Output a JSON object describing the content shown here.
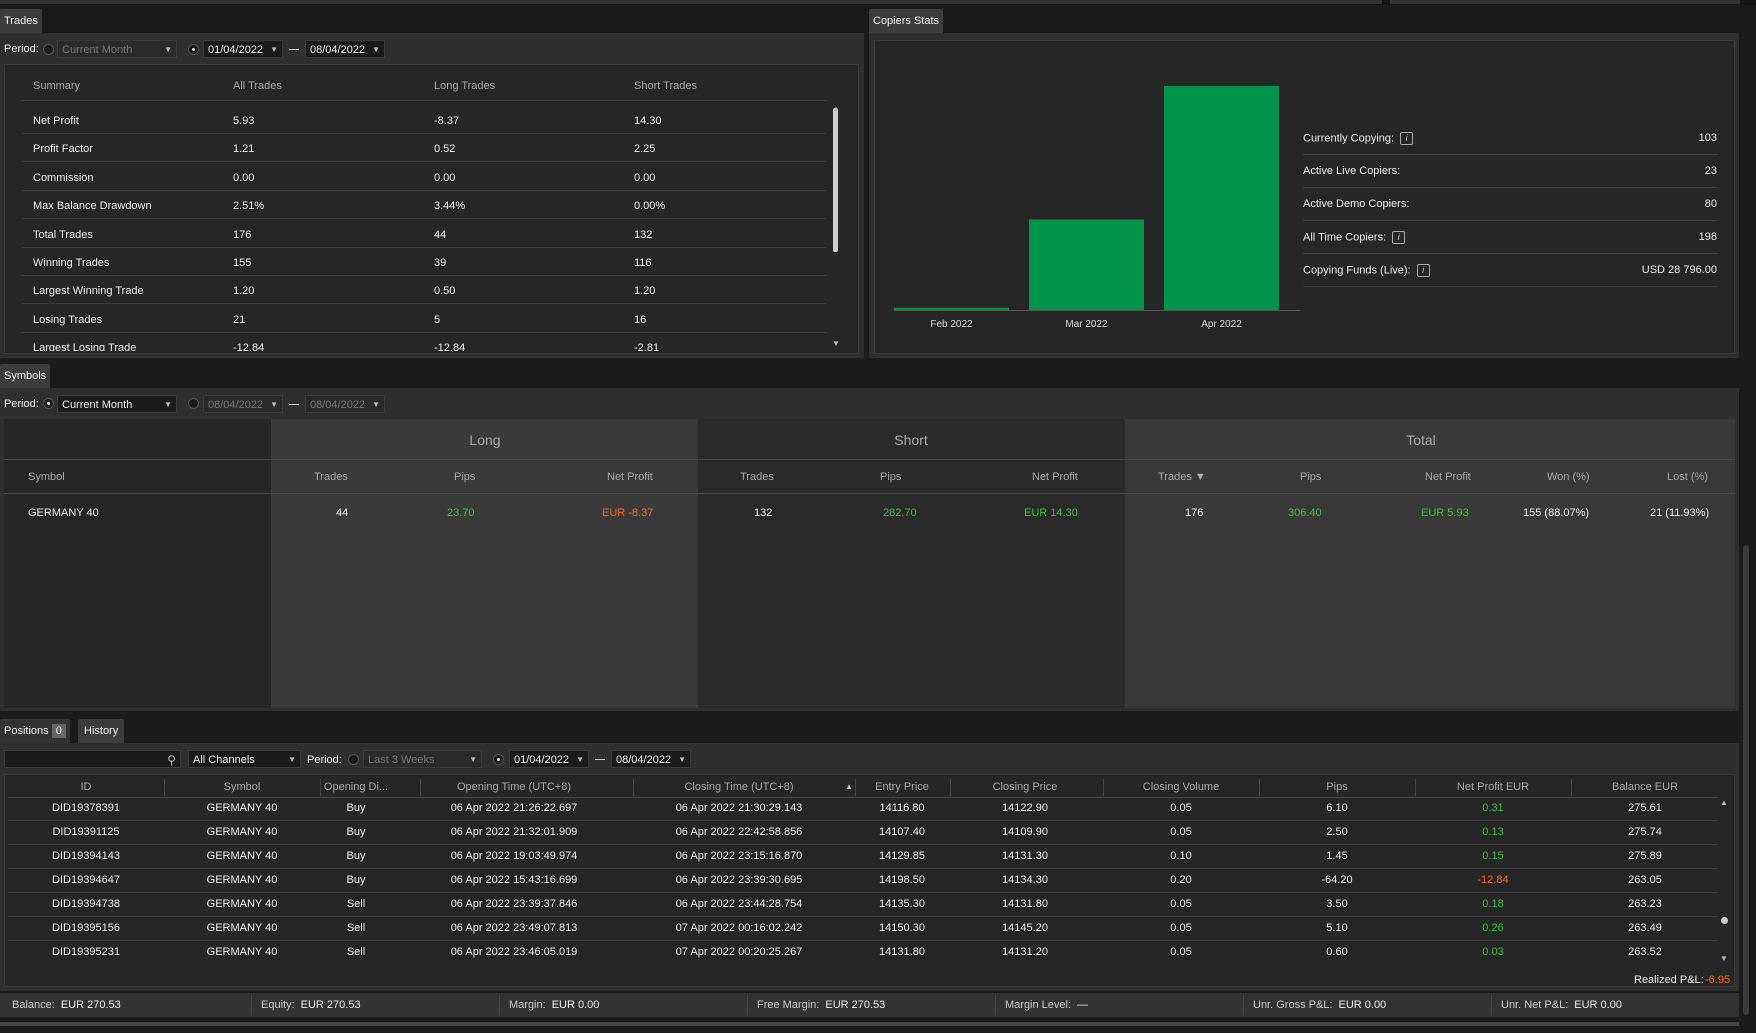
{
  "trades": {
    "tab": "Trades",
    "period_label": "Period:",
    "period_select": "Current Month",
    "date_from": "01/04/2022",
    "date_to": "08/04/2022",
    "columns": [
      "Summary",
      "All Trades",
      "Long Trades",
      "Short Trades"
    ],
    "rows": [
      [
        "Net Profit",
        "5.93",
        "-8.37",
        "14.30"
      ],
      [
        "Profit Factor",
        "1.21",
        "0.52",
        "2.25"
      ],
      [
        "Commission",
        "0.00",
        "0.00",
        "0.00"
      ],
      [
        "Max Balance Drawdown",
        "2.51%",
        "3.44%",
        "0.00%"
      ],
      [
        "Total Trades",
        "176",
        "44",
        "132"
      ],
      [
        "Winning Trades",
        "155",
        "39",
        "116"
      ],
      [
        "Largest Winning Trade",
        "1.20",
        "0.50",
        "1.20"
      ],
      [
        "Losing Trades",
        "21",
        "5",
        "16"
      ],
      [
        "Largest Losing Trade",
        "-12.84",
        "-12.84",
        "-2.81"
      ]
    ]
  },
  "copiers": {
    "tab": "Copiers Stats",
    "stats": [
      {
        "label": "Currently Copying:",
        "value": "103",
        "info": true
      },
      {
        "label": "Active Live Copiers:",
        "value": "23",
        "info": false
      },
      {
        "label": "Active Demo Copiers:",
        "value": "80",
        "info": false
      },
      {
        "label": "All Time Copiers:",
        "value": "198",
        "info": true
      },
      {
        "label": "Copying Funds (Live):",
        "value": "USD 28 796.00",
        "info": true
      }
    ]
  },
  "chart_data": {
    "type": "bar",
    "categories": [
      "Feb 2022",
      "Mar 2022",
      "Apr 2022"
    ],
    "values": [
      2,
      80,
      198
    ],
    "ylim": [
      0,
      205
    ],
    "bar_color": "#00954a",
    "grid": false
  },
  "symbols": {
    "tab": "Symbols",
    "period_label": "Period:",
    "period_select": "Current Month",
    "date_from": "08/04/2022",
    "date_to": "08/04/2022",
    "groups": [
      "Long",
      "Short",
      "Total"
    ],
    "headers": {
      "symbol": "Symbol",
      "long": [
        "Trades",
        "Pips",
        "Net Profit"
      ],
      "short": [
        "Trades",
        "Pips",
        "Net Profit"
      ],
      "total": [
        "Trades ▼",
        "Pips",
        "Net Profit",
        "Won (%)",
        "Lost (%)"
      ]
    },
    "row": {
      "symbol": "GERMANY 40",
      "long": [
        "44",
        "23.70",
        "EUR -8.37"
      ],
      "short": [
        "132",
        "282.70",
        "EUR 14.30"
      ],
      "total": [
        "176",
        "306.40",
        "EUR 5.93",
        "155 (88.07%)",
        "21 (11.93%)"
      ]
    }
  },
  "history": {
    "tab_positions": "Positions",
    "positions_count": "0",
    "tab_history": "History",
    "search_value": "",
    "channels": "All Channels",
    "period_label": "Period:",
    "period_select": "Last 3 Weeks",
    "date_from": "01/04/2022",
    "date_to": "08/04/2022",
    "columns": [
      "ID",
      "Symbol",
      "Opening Di...",
      "Opening Time (UTC+8)",
      "Closing Time (UTC+8)",
      "Entry Price",
      "Closing Price",
      "Closing Volume",
      "Pips",
      "Net Profit EUR",
      "Balance EUR"
    ],
    "sort_indicator": "▲",
    "rows": [
      [
        "DID19378391",
        "GERMANY 40",
        "Buy",
        "06 Apr 2022 21:26:22.697",
        "06 Apr 2022 21:30:29.143",
        "14116.80",
        "14122.90",
        "0.05",
        "6.10",
        "0.31",
        "275.61"
      ],
      [
        "DID19391125",
        "GERMANY 40",
        "Buy",
        "06 Apr 2022 21:32:01.909",
        "06 Apr 2022 22:42:58.856",
        "14107.40",
        "14109.90",
        "0.05",
        "2.50",
        "0.13",
        "275.74"
      ],
      [
        "DID19394143",
        "GERMANY 40",
        "Buy",
        "06 Apr 2022 19:03:49.974",
        "06 Apr 2022 23:15:16.870",
        "14129.85",
        "14131.30",
        "0.10",
        "1.45",
        "0.15",
        "275.89"
      ],
      [
        "DID19394647",
        "GERMANY 40",
        "Buy",
        "06 Apr 2022 15:43:16.699",
        "06 Apr 2022 23:39:30.695",
        "14198.50",
        "14134.30",
        "0.20",
        "-64.20",
        "-12.84",
        "263.05"
      ],
      [
        "DID19394738",
        "GERMANY 40",
        "Sell",
        "06 Apr 2022 23:39:37.846",
        "06 Apr 2022 23:44:28.754",
        "14135.30",
        "14131.80",
        "0.05",
        "3.50",
        "0.18",
        "263.23"
      ],
      [
        "DID19395156",
        "GERMANY 40",
        "Sell",
        "06 Apr 2022 23:49:07.813",
        "07 Apr 2022 00:16:02.242",
        "14150.30",
        "14145.20",
        "0.05",
        "5.10",
        "0.26",
        "263.49"
      ],
      [
        "DID19395231",
        "GERMANY 40",
        "Sell",
        "06 Apr 2022 23:46:05.019",
        "07 Apr 2022 00:20:25.267",
        "14131.80",
        "14131.20",
        "0.05",
        "0.60",
        "0.03",
        "263.52"
      ]
    ],
    "realized_label": "Realized P&L:",
    "realized_value": "-6.95"
  },
  "footer": [
    {
      "label": "Balance:",
      "value": "EUR 270.53"
    },
    {
      "label": "Equity:",
      "value": "EUR 270.53"
    },
    {
      "label": "Margin:",
      "value": "EUR 0.00"
    },
    {
      "label": "Free Margin:",
      "value": "EUR 270.53"
    },
    {
      "label": "Margin Level:",
      "value": "—"
    },
    {
      "label": "Unr. Gross P&L:",
      "value": "EUR 0.00"
    },
    {
      "label": "Unr. Net P&L:",
      "value": "EUR 0.00"
    }
  ]
}
